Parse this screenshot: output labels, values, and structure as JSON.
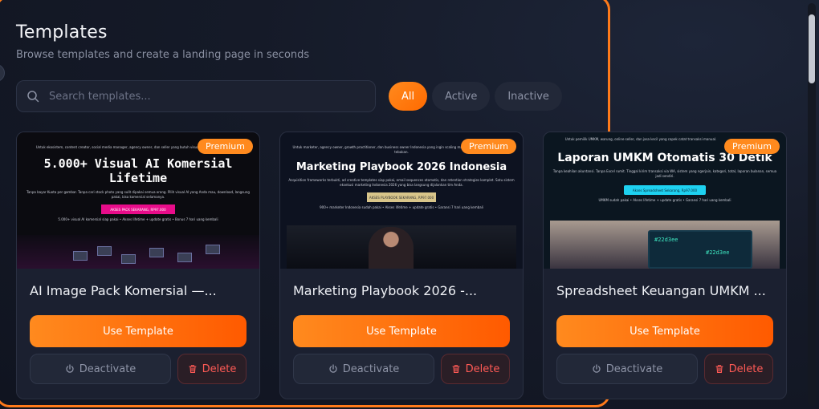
{
  "page": {
    "title": "Templates",
    "subtitle": "Browse templates and create a landing page in seconds"
  },
  "search": {
    "placeholder": "Search templates..."
  },
  "filters": [
    {
      "label": "All",
      "active": true
    },
    {
      "label": "Active",
      "active": false
    },
    {
      "label": "Inactive",
      "active": false
    }
  ],
  "colors": {
    "accent": "#ff7a1a",
    "danger": "#ff5a55"
  },
  "cards": [
    {
      "badge": "Premium",
      "title": "AI Image Pack Komersial —...",
      "use_label": "Use Template",
      "deactivate_label": "Deactivate",
      "delete_label": "Delete",
      "thumb": {
        "intro": "Untuk ekosistem, content creator, social media manager, agency owner, dan seller yang butuh visual AI komersial tanpa ribet.",
        "headline": "5.000+ Visual AI Komersial Lifetime",
        "body": "Tanpa bayar Kuota per gambar. Tanpa cari stock photo yang sulit dipakai semua orang. Pilih visual AI yang Anda mau, download, langsung pakai, bisa komersial selamanya.",
        "cta": "AKSES PACK SEKARANG, RP97.000",
        "footer": "5.000+ visual AI komersial siap pakai • Akses lifetime + update gratis • Bonus 7 hari uang kembali"
      }
    },
    {
      "badge": "Premium",
      "title": "Marketing Playbook 2026 -...",
      "use_label": "Use Template",
      "deactivate_label": "Deactivate",
      "delete_label": "Delete",
      "thumb": {
        "intro": "Untuk marketer, agency owner, growth practitioner, dan business owner Indonesia yang ingin scaling marketing dengan sistem, bukan tebakan.",
        "headline": "Marketing Playbook 2026 Indonesia",
        "body": "Acquisition frameworks terbukti, ad creative templates siap pakai, email sequences otomatis, dan retention strategies komplet. Satu sistem eksekusi marketing Indonesia 2026 yang bisa langsung dijalankan tim Anda.",
        "cta": "AKSES PLAYBOOK SEKARANG, RP97.000",
        "footer": "900+ marketer Indonesia sudah pakai • Akses lifetime + update gratis • Garansi 7 hari uang kembali"
      }
    },
    {
      "badge": "Premium",
      "title": "Spreadsheet Keuangan UMKM ...",
      "use_label": "Use Template",
      "deactivate_label": "Deactivate",
      "delete_label": "Delete",
      "thumb": {
        "intro": "Untuk pemilik UMKM, warung, online seller, dan jasa kecil yang capek catat transaksi manual.",
        "headline": "Laporan UMKM Otomatis 30 Detik",
        "body": "Tanpa keahlian akuntansi. Tanpa Excel rumit. Tinggal kirim transaksi via WA, sistem yang ngerjain, kategori, total, laporan bulanan, semua jadi sendiri.",
        "cta": "Akses Spreadsheet Sekarang, Rp97.000",
        "footer": "UMKM sudah pakai • Akses lifetime + update gratis • Garansi 7 hari uang kembali",
        "screen_a": "#22d3ee",
        "screen_b": "#22d3ee"
      }
    }
  ]
}
